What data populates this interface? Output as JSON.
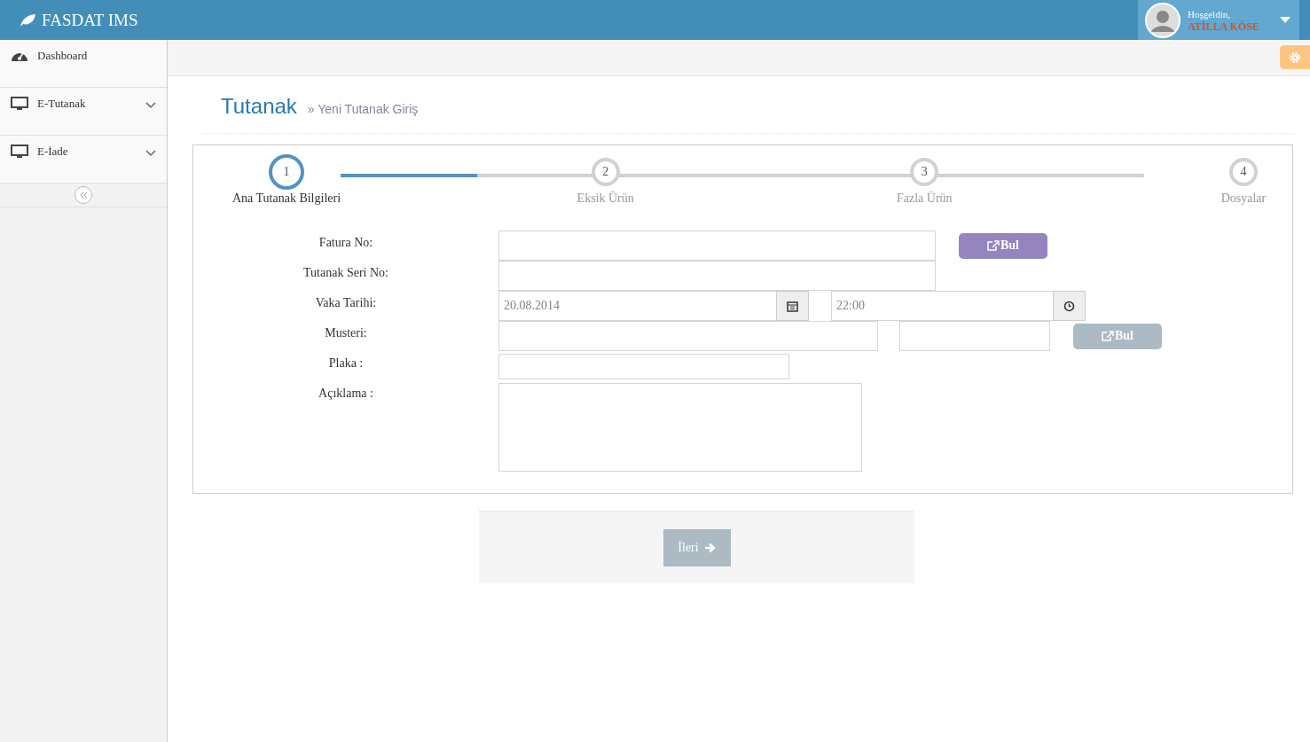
{
  "header": {
    "brand": "FASDAT IMS",
    "user": {
      "greeting": "Hoşgeldin,",
      "name": "ATİLLA KÖSE"
    }
  },
  "sidebar": {
    "items": [
      {
        "label": "Dashboard",
        "kind": "link"
      },
      {
        "label": "E-Tutanak",
        "kind": "group",
        "expanded": false
      },
      {
        "label": "E-İade",
        "kind": "group",
        "expanded": false
      }
    ]
  },
  "page": {
    "title": "Tutanak",
    "breadcrumb": "» Yeni Tutanak Giriş"
  },
  "wizard": {
    "level": 0.17,
    "steps": [
      {
        "number": "1",
        "label": "Ana Tutanak Bilgileri",
        "selected": true
      },
      {
        "number": "2",
        "label": "Eksik Ürün",
        "selected": false
      },
      {
        "number": "3",
        "label": "Fazla Ürün",
        "selected": false
      },
      {
        "number": "4",
        "label": "Dosyalar",
        "selected": false
      }
    ]
  },
  "form": {
    "fatura_label": "Fatura No:",
    "fatura_button": {
      "label": "Bul",
      "disabled": false
    },
    "seri_label": "Tutanak Seri No:",
    "tarih_label": "Vaka Tarihi:",
    "date_value": "20.08.2014",
    "time_value": "22:00",
    "musteri_label": "Musteri:",
    "musteri_button": {
      "label": "Bul",
      "disabled": true
    },
    "plaka_label": "Plaka :",
    "aciklama_label": "Açıklama :"
  },
  "next_button": "İleri"
}
